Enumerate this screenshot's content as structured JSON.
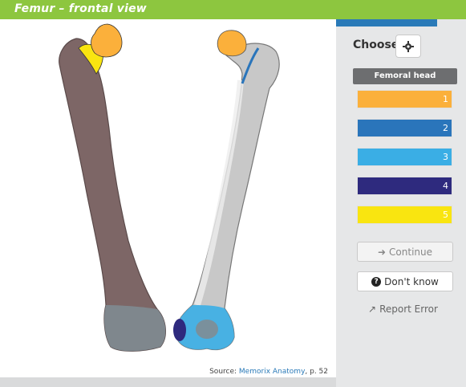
{
  "header": {
    "title": "Femur – frontal view"
  },
  "source": {
    "prefix": "Source:",
    "link": "Memorix Anatomy",
    "suffix": ", p. 52"
  },
  "panel": {
    "choose_label": "Choose",
    "target_label": "Femoral head",
    "options": [
      {
        "number": "1",
        "color": "#fbb03b"
      },
      {
        "number": "2",
        "color": "#2a75bb"
      },
      {
        "number": "3",
        "color": "#3aaee5"
      },
      {
        "number": "4",
        "color": "#2e2a7e"
      },
      {
        "number": "5",
        "color": "#f9e510"
      }
    ],
    "continue_label": "Continue",
    "dont_know_label": "Don't know",
    "report_label": "Report Error"
  }
}
